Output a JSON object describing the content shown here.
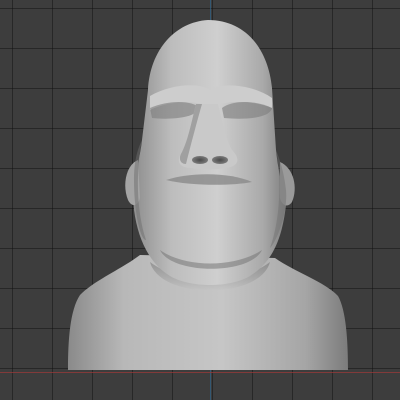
{
  "viewport": {
    "background_color": "#3d3d3d",
    "grid_line_color": "#2a2a2a",
    "axis_x_color": "#9a3a3a",
    "axis_y_color": "#2e6f9e"
  },
  "model": {
    "name": "moai-head-bust",
    "material_color": "#c2c2c2",
    "shading": "solid-matcap"
  }
}
